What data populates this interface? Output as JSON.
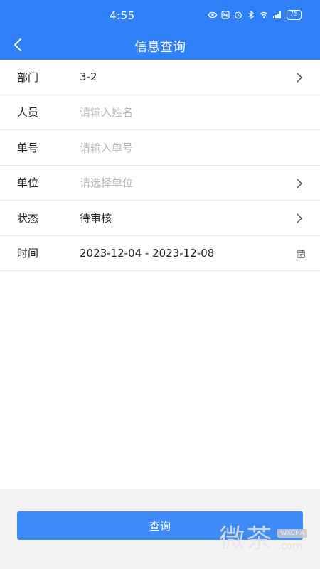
{
  "status_bar": {
    "time": "4:55",
    "battery": "75",
    "icons": [
      "eye-icon",
      "nfc-icon",
      "alarm-icon",
      "bluetooth-icon",
      "wifi-icon",
      "signal-5g-icon",
      "battery-icon"
    ]
  },
  "nav": {
    "title": "信息查询",
    "back_icon": "chevron-left-icon"
  },
  "form": {
    "department": {
      "label": "部门",
      "value": "3-2"
    },
    "person": {
      "label": "人员",
      "placeholder": "请输入姓名"
    },
    "order_no": {
      "label": "单号",
      "placeholder": "请输入单号"
    },
    "unit": {
      "label": "单位",
      "placeholder": "请选择单位"
    },
    "status": {
      "label": "状态",
      "value": "待审核"
    },
    "time": {
      "label": "时间",
      "value": "2023-12-04 - 2023-12-08"
    }
  },
  "actions": {
    "query_label": "查询"
  },
  "watermark": {
    "text_cn": "微茶",
    "badge": "WXCHA",
    "suffix": ".com"
  },
  "colors": {
    "primary": "#2f7ff6",
    "button": "#3d8bf7",
    "placeholder": "#b5b5b5",
    "divider": "#e8e8e8"
  }
}
